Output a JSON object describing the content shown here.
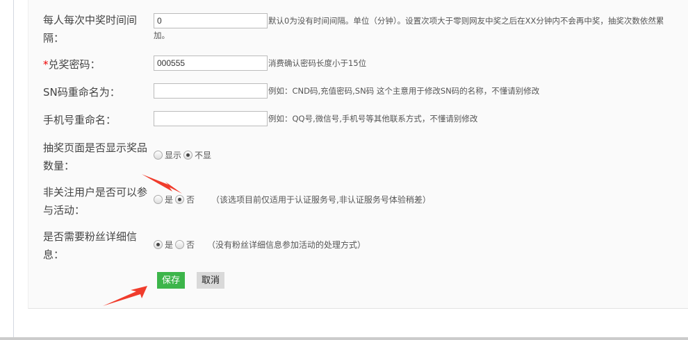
{
  "fields": {
    "interval": {
      "label": "每人每次中奖时间间隔：",
      "value": "0",
      "hint": "默认0为没有时间间隔。单位（分钟）。设置次项大于零则网友中奖之后在XX分钟内不会再中奖，抽奖次数依然累",
      "hint2": "加。"
    },
    "password": {
      "required_mark": "*",
      "label": "兑奖密码：",
      "value": "000555",
      "hint": "消费确认密码长度小于15位"
    },
    "sn_rename": {
      "label": "SN码重命名为：",
      "value": "",
      "hint": "例如：CND码,充值密码,SN码 这个主意用于修改SN码的名称，不懂请别修改"
    },
    "phone_rename": {
      "label": "手机号重命名：",
      "value": "",
      "hint": "例如：QQ号,微信号,手机号等其他联系方式，不懂请别修改"
    },
    "show_count": {
      "label": "抽奖页面是否显示奖品数量：",
      "options": [
        "显示",
        "不显"
      ],
      "selected": "不显"
    },
    "non_follower": {
      "label": "非关注用户是否可以参与活动：",
      "options": [
        "是",
        "否"
      ],
      "selected": "否",
      "hint": "（该选项目前仅适用于认证服务号,非认证服务号体验稍差）"
    },
    "fan_info": {
      "label": "是否需要粉丝详细信息：",
      "options": [
        "是",
        "否"
      ],
      "selected": "是",
      "hint": "（没有粉丝详细信息参加活动的处理方式）"
    }
  },
  "buttons": {
    "save": "保存",
    "cancel": "取消"
  },
  "colors": {
    "save": "#3cb54a",
    "arrow": "#f03c2c"
  }
}
